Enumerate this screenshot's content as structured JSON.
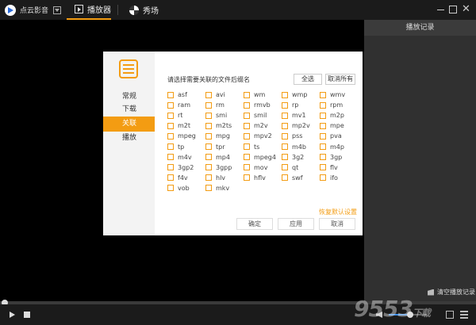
{
  "app": {
    "name": "点云影音"
  },
  "tabs": {
    "player": "播放器",
    "show": "秀场"
  },
  "history": {
    "title": "播放记录",
    "clear_label": "清空播放记录"
  },
  "dialog": {
    "nav": [
      "常规",
      "下载",
      "关联",
      "播放"
    ],
    "active_nav": "关联",
    "prompt": "请选择需要关联的文件后缀名",
    "select_all": "全选",
    "deselect_all": "取消所有",
    "extensions": [
      "asf",
      "avi",
      "wm",
      "wmp",
      "wmv",
      "ram",
      "rm",
      "rmvb",
      "rp",
      "rpm",
      "rt",
      "smi",
      "smil",
      "mv1",
      "m2p",
      "m2t",
      "m2ts",
      "m2v",
      "mp2v",
      "mpe",
      "mpeg",
      "mpg",
      "mpv2",
      "pss",
      "pva",
      "tp",
      "tpr",
      "ts",
      "m4b",
      "m4p",
      "m4v",
      "mp4",
      "mpeg4",
      "3g2",
      "3gp",
      "3gp2",
      "3gpp",
      "mov",
      "qt",
      "flv",
      "f4v",
      "hlv",
      "hflv",
      "swf",
      "ifo",
      "vob",
      "mkv"
    ],
    "restore_defaults": "恢复默认设置",
    "ok": "确定",
    "apply": "应用",
    "cancel": "取消"
  },
  "playback": {
    "progress": 0.01,
    "volume": 0.55
  },
  "watermark": {
    "text": "9553",
    "suffix": "下载"
  },
  "colors": {
    "accent": "#f39c12",
    "volume": "#3c8ee8"
  }
}
